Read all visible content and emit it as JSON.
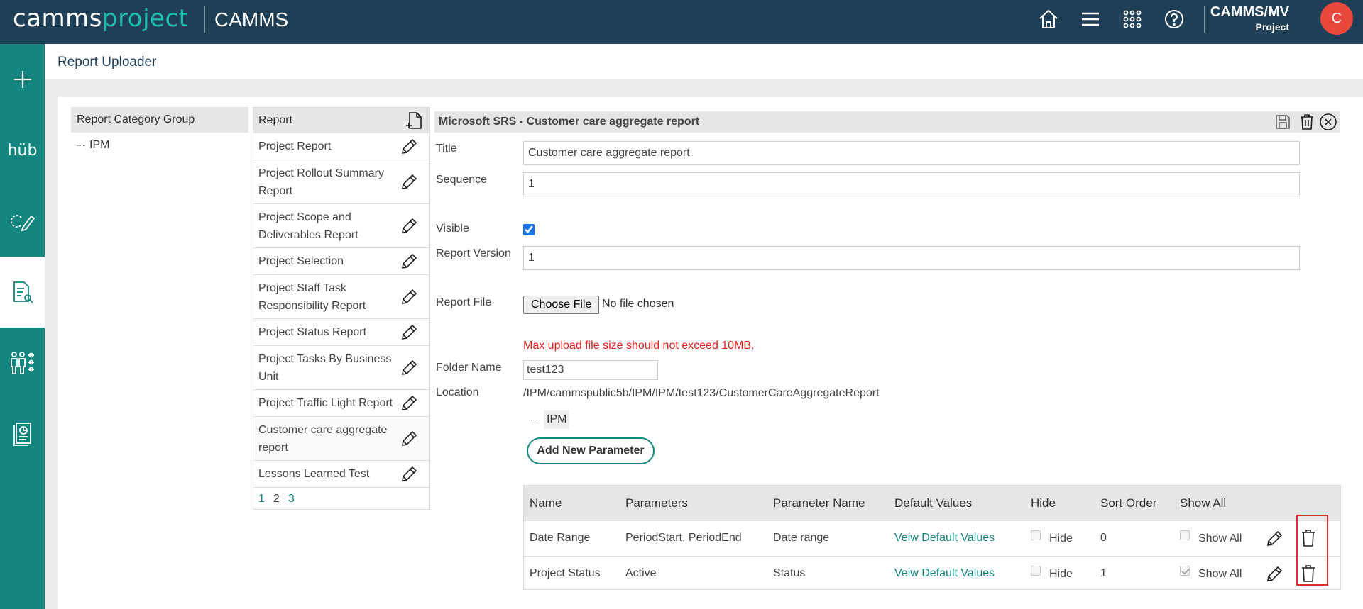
{
  "header": {
    "logo_part1": "camms",
    "logo_part2": "project",
    "app_name": "CAMMS",
    "icons": [
      "home-icon",
      "menu-icon",
      "apps-grid-icon",
      "help-icon"
    ],
    "user_name": "CAMMS/MV",
    "user_role": "Project",
    "avatar_letter": "C"
  },
  "sidebar": {
    "items": [
      {
        "icon": "plus-icon"
      },
      {
        "icon": "hub-icon",
        "label": "hüb"
      },
      {
        "icon": "cycle-pencil-icon"
      },
      {
        "icon": "report-search-icon",
        "active": true
      },
      {
        "icon": "people-settings-icon"
      },
      {
        "icon": "report-book-icon"
      }
    ]
  },
  "page": {
    "title": "Report Uploader"
  },
  "category": {
    "header": "Report Category Group",
    "tree_item": "IPM"
  },
  "reports": {
    "header": "Report",
    "items": [
      "Project Report",
      "Project Rollout Summary Report",
      "Project Scope and Deliverables Report",
      "Project Selection",
      "Project Staff Task Responsibility Report",
      "Project Status Report",
      "Project Tasks By Business Unit",
      "Project Traffic Light Report",
      "Customer care aggregate report",
      "Lessons Learned Test"
    ],
    "pages": [
      "1",
      "2",
      "3"
    ]
  },
  "detail": {
    "header": "Microsoft SRS - Customer care aggregate report",
    "title_label": "Title",
    "title_value": "Customer care aggregate report",
    "sequence_label": "Sequence",
    "sequence_value": "1",
    "visible_label": "Visible",
    "visible_checked": true,
    "version_label": "Report Version",
    "version_value": "1",
    "file_label": "Report File",
    "choose_file": "Choose File",
    "no_file": "No file chosen",
    "warning": "Max upload file size should not exceed 10MB.",
    "folder_label": "Folder Name",
    "folder_value": "test123",
    "location_label": "Location",
    "location_path": "/IPM/cammspublic5b/IPM/IPM/test123/CustomerCareAggregateReport",
    "location_tree": "IPM",
    "add_param": "Add New Parameter"
  },
  "params": {
    "headers": [
      "Name",
      "Parameters",
      "Parameter Name",
      "Default Values",
      "Hide",
      "Sort Order",
      "Show All"
    ],
    "rows": [
      {
        "name": "Date Range",
        "parameters": "PeriodStart, PeriodEnd",
        "param_name": "Date range",
        "default": "Veiw Default Values",
        "hide": "Hide",
        "hide_checked": false,
        "sort": "0",
        "show_all": "Show All",
        "show_all_checked": false
      },
      {
        "name": "Project Status",
        "parameters": "Active",
        "param_name": "Status",
        "default": "Veiw Default Values",
        "hide": "Hide",
        "hide_checked": false,
        "sort": "1",
        "show_all": "Show All",
        "show_all_checked": true
      }
    ]
  },
  "colors": {
    "topbar": "#1f3f57",
    "sidebar": "#13877f",
    "accent": "#1fbcb0",
    "warning": "#e0201d"
  }
}
